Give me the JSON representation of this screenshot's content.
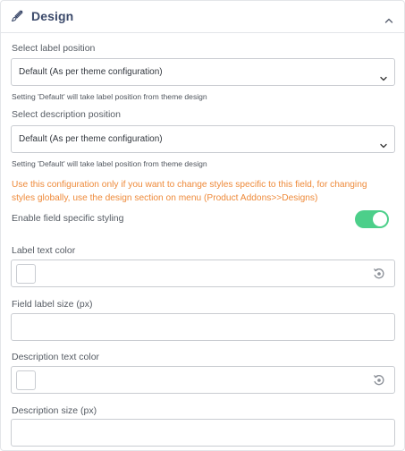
{
  "header": {
    "title": "Design",
    "icon": "paintbrush-icon",
    "collapse_icon": "chevron-up-icon"
  },
  "label_position": {
    "label": "Select label position",
    "value": "Default (As per theme configuration)",
    "hint": "Setting 'Default' will take label position from theme design"
  },
  "description_position": {
    "label": "Select description position",
    "value": "Default (As per theme configuration)",
    "hint": "Setting 'Default' will take label position from theme design"
  },
  "notice": "Use this configuration only if you want to change styles specific to this field, for changing styles globally, use the design section on menu (Product Addons>>Designs)",
  "field_styling": {
    "label": "Enable field specific styling",
    "enabled": true,
    "toggle_color": "#4ccf8a"
  },
  "label_text_color": {
    "label": "Label text color",
    "value": "#ffffff"
  },
  "field_label_size": {
    "label": "Field label size (px)",
    "value": ""
  },
  "description_text_color": {
    "label": "Description text color",
    "value": "#ffffff"
  },
  "description_size": {
    "label": "Description size (px)",
    "value": ""
  },
  "colors": {
    "title": "#3c4a6b",
    "notice": "#ee8a3a",
    "border": "#c9ccd1"
  }
}
